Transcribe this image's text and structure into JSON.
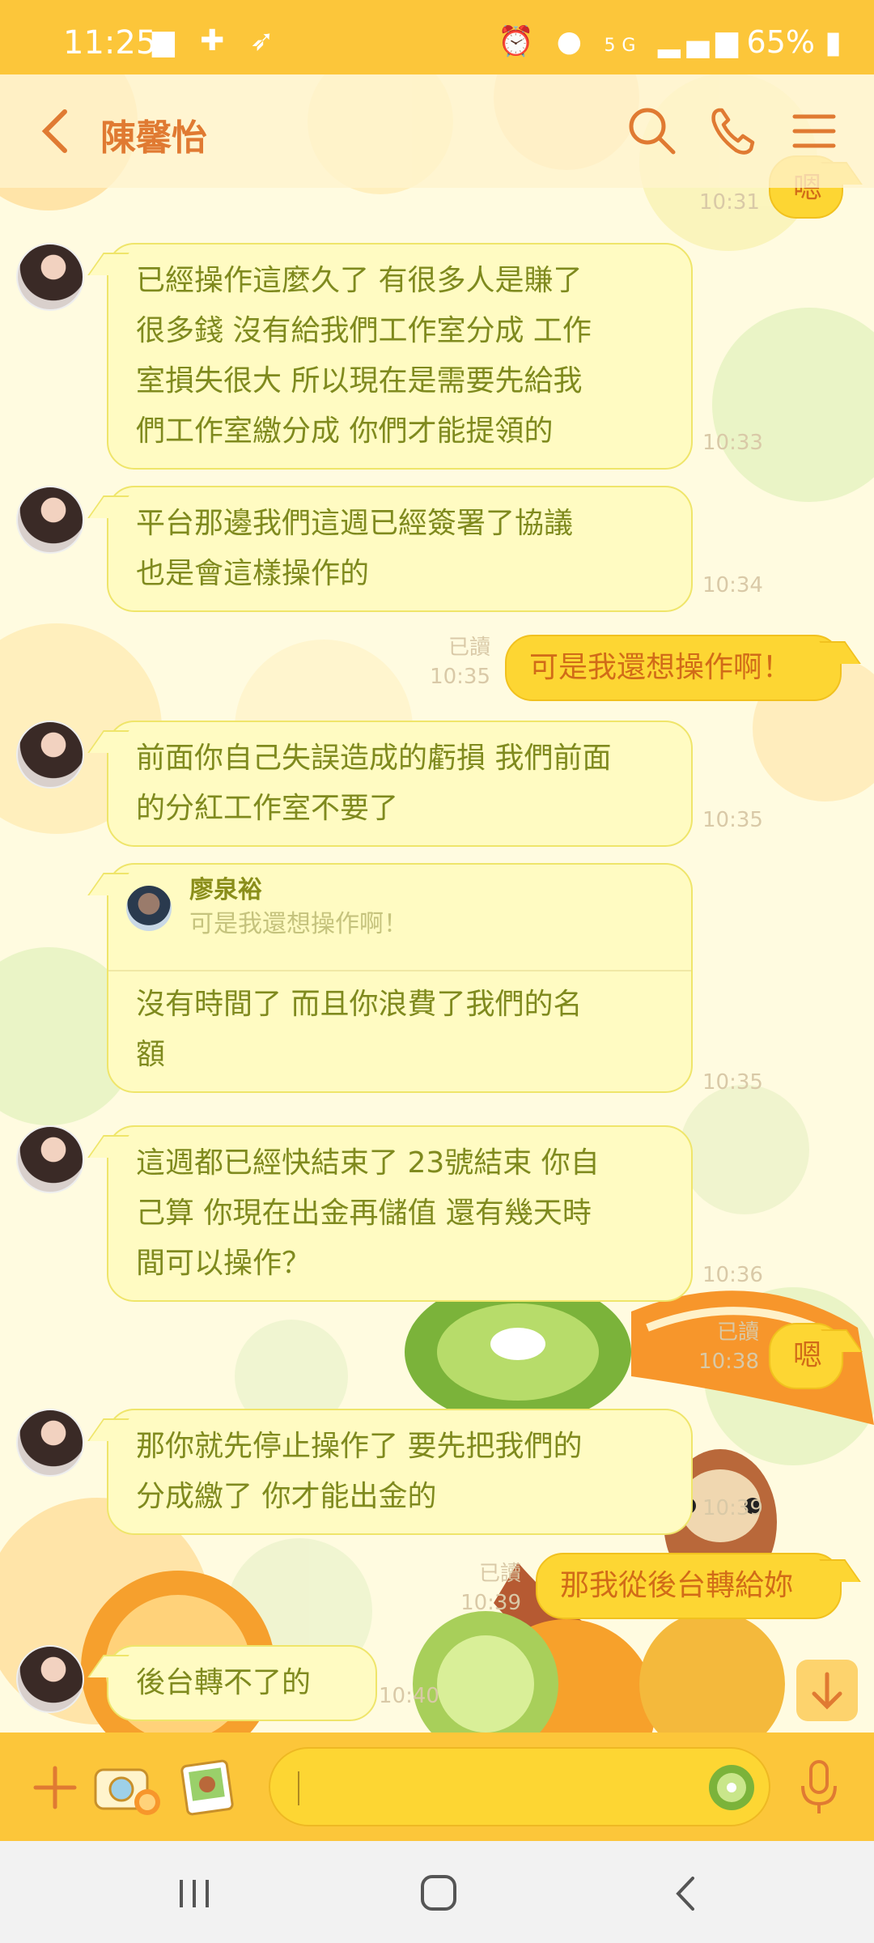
{
  "status_bar": {
    "time": "11:25",
    "battery": "65%",
    "network": "5G"
  },
  "header": {
    "title": "陳馨怡"
  },
  "messages": [
    {
      "dir": "out",
      "text": "嗯",
      "time": "10:31"
    },
    {
      "dir": "in",
      "lines": [
        "已經操作這麼久了 有很多人是賺了",
        "很多錢 沒有給我們工作室分成 工作",
        "室損失很大 所以現在是需要先給我",
        "們工作室繳分成 你們才能提領的"
      ],
      "time": "10:33"
    },
    {
      "dir": "in",
      "lines": [
        "平台那邊我們這週已經簽署了協議",
        "也是會這樣操作的"
      ],
      "time": "10:34"
    },
    {
      "dir": "out",
      "text": "可是我還想操作啊！",
      "read": "已讀",
      "time": "10:35"
    },
    {
      "dir": "in",
      "lines": [
        "前面你自己失誤造成的虧損 我們前面",
        "的分紅工作室不要了"
      ],
      "time": "10:35"
    },
    {
      "dir": "in",
      "reply_name": "廖泉裕",
      "reply_text": "可是我還想操作啊！",
      "lines": [
        "沒有時間了 而且你浪費了我們的名",
        "額"
      ],
      "time": "10:35"
    },
    {
      "dir": "in",
      "lines": [
        "這週都已經快結束了 23號結束 你自",
        "己算 你現在出金再儲值 還有幾天時",
        "間可以操作？"
      ],
      "time": "10:36"
    },
    {
      "dir": "out",
      "text": "嗯",
      "read": "已讀",
      "time": "10:38"
    },
    {
      "dir": "in",
      "lines": [
        "那你就先停止操作了 要先把我們的",
        "分成繳了 你才能出金的"
      ],
      "time": "10:39"
    },
    {
      "dir": "out",
      "text": "那我從後台轉給妳",
      "read": "已讀",
      "time": "10:39"
    },
    {
      "dir": "in",
      "lines": [
        "後台轉不了的"
      ],
      "time": "10:40"
    }
  ],
  "input": {
    "placeholder": "",
    "value": ""
  },
  "colors": {
    "accent": "#fcc63a",
    "incoming_bubble": "#fffbc2",
    "outgoing_bubble": "#fdd633",
    "incoming_text": "#7f8a1e",
    "outgoing_text": "#d16b18",
    "title": "#e07a32"
  }
}
